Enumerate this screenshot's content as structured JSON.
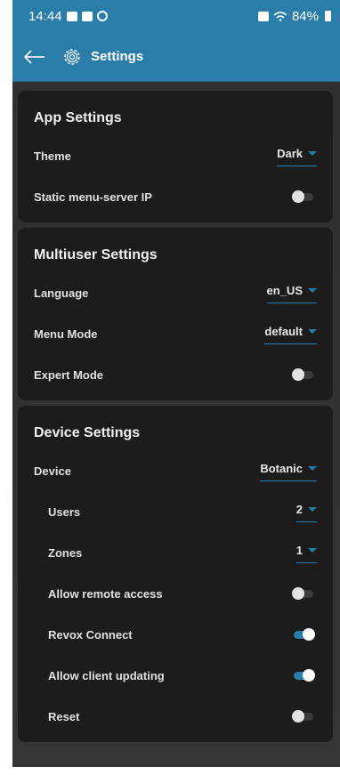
{
  "status_bar": {
    "time": "14:44",
    "battery": "84%"
  },
  "header": {
    "title": "Settings"
  },
  "app_settings": {
    "title": "App Settings",
    "theme_label": "Theme",
    "theme_value": "Dark",
    "static_ip_label": "Static menu-server IP",
    "static_ip_on": false
  },
  "multiuser_settings": {
    "title": "Multiuser Settings",
    "language_label": "Language",
    "language_value": "en_US",
    "menu_mode_label": "Menu Mode",
    "menu_mode_value": "default",
    "expert_mode_label": "Expert Mode",
    "expert_mode_on": false
  },
  "device_settings": {
    "title": "Device Settings",
    "device_label": "Device",
    "device_value": "Botanic",
    "users_label": "Users",
    "users_value": "2",
    "zones_label": "Zones",
    "zones_value": "1",
    "remote_access_label": "Allow remote access",
    "remote_access_on": false,
    "revox_connect_label": "Revox Connect",
    "revox_connect_on": true,
    "client_updating_label": "Allow client updating",
    "client_updating_on": true,
    "reset_label": "Reset",
    "reset_on": false
  },
  "colors": {
    "accent": "#2a7da8",
    "card": "#1c1c1c",
    "background": "#2f2f2f"
  },
  "icons": {
    "back": "arrow-left-icon",
    "settings": "gear-icon"
  }
}
